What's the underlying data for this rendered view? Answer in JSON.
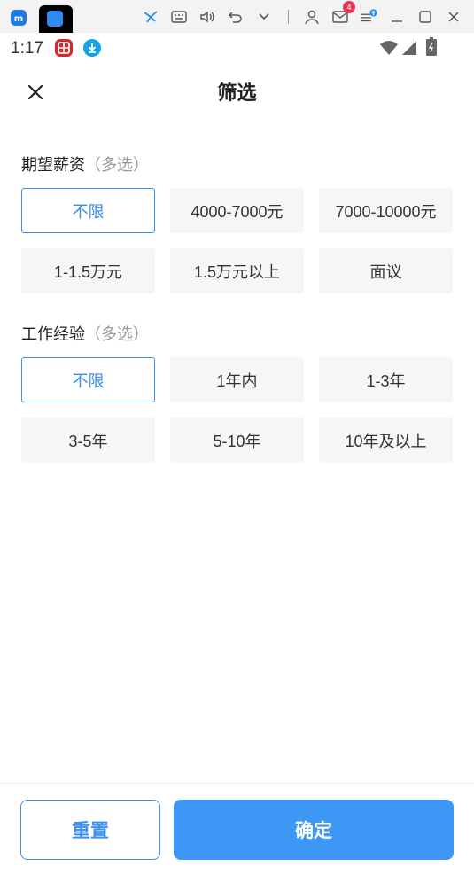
{
  "status_bar": {
    "time": "1:17"
  },
  "emulator": {
    "notification_count": "4"
  },
  "header": {
    "title": "筛选"
  },
  "salary": {
    "title": "期望薪资",
    "hint": "（多选）",
    "options": [
      "不限",
      "4000-7000元",
      "7000-10000元",
      "1-1.5万元",
      "1.5万元以上",
      "面议"
    ],
    "selected": "不限"
  },
  "experience": {
    "title": "工作经验",
    "hint": "（多选）",
    "options": [
      "不限",
      "1年内",
      "1-3年",
      "3-5年",
      "5-10年",
      "10年及以上"
    ],
    "selected": "不限"
  },
  "footer": {
    "reset_label": "重置",
    "confirm_label": "确定"
  },
  "colors": {
    "accent": "#3a8ff2",
    "chip_bg": "#f5f6f8",
    "confirm_bg": "#3d97f4"
  }
}
